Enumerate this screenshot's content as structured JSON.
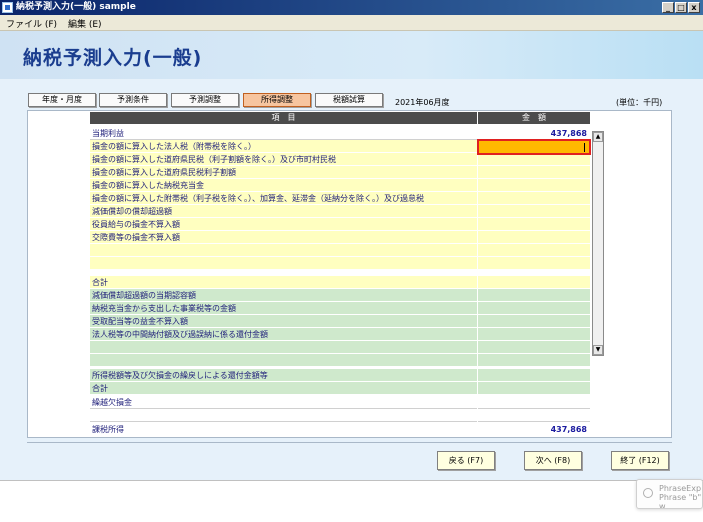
{
  "window": {
    "title": "納税予測入力(一般) sample",
    "minimize": "_",
    "maximize": "□",
    "close": "x"
  },
  "menu": [
    {
      "label": "ファイル (F)"
    },
    {
      "label": "編集 (E)"
    }
  ],
  "header": {
    "title": "納税予測入力(一般)"
  },
  "tabs": [
    {
      "label": "年度・月度"
    },
    {
      "label": "予測条件"
    },
    {
      "label": "予測調整"
    },
    {
      "label": "所得調整"
    },
    {
      "label": "税額試算"
    }
  ],
  "active_tab": "所得調整",
  "period": "2021年06月度",
  "unit": "(単位：千円)",
  "columns": {
    "item": "項　目",
    "amount": "金　額"
  },
  "rows": [
    {
      "label": "当期利益",
      "amount": "437,868"
    },
    {
      "label": "損金の額に算入した法人税（附帯税を除く。）",
      "amount": ""
    },
    {
      "label": "損金の額に算入した道府県民税（利子割額を除く。）及び市町村民税",
      "amount": ""
    },
    {
      "label": "損金の額に算入した道府県民税利子割額",
      "amount": ""
    },
    {
      "label": "損金の額に算入した納税充当金",
      "amount": ""
    },
    {
      "label": "損金の額に算入した附帯税（利子税を除く。）、加算金、延滞金（延納分を除く。）及び過怠税",
      "amount": ""
    },
    {
      "label": "減価償却の償却超過額",
      "amount": ""
    },
    {
      "label": "役員給与の損金不算入額",
      "amount": ""
    },
    {
      "label": "交際費等の損金不算入額",
      "amount": ""
    },
    {
      "label": "",
      "amount": ""
    },
    {
      "label": "",
      "amount": ""
    },
    {
      "label": "合計",
      "amount": ""
    },
    {
      "label": "減価償却超過額の当期認容額",
      "amount": ""
    },
    {
      "label": "納税充当金から支出した事業税等の金額",
      "amount": ""
    },
    {
      "label": "受取配当等の益金不算入額",
      "amount": ""
    },
    {
      "label": "法人税等の中間納付額及び過誤納に係る還付金額",
      "amount": ""
    },
    {
      "label": "",
      "amount": ""
    },
    {
      "label": "",
      "amount": ""
    },
    {
      "label": "所得税額等及び欠損金の繰戻しによる還付金額等",
      "amount": ""
    },
    {
      "label": "合計",
      "amount": ""
    },
    {
      "label": "繰越欠損金",
      "amount": ""
    },
    {
      "label": "",
      "amount": ""
    },
    {
      "label": "課税所得",
      "amount": "437,868"
    }
  ],
  "buttons": {
    "back": "戻る (F7)",
    "next": "次へ (F8)",
    "exit": "終了 (F12)"
  },
  "ime": {
    "line1": "PhraseExp",
    "line2": "Phrase \"b\" w"
  },
  "colors": {
    "header_text": "#1a3d8f",
    "active_tab": "#f7c59f",
    "add_rows": "#ffffc0",
    "deduct_rows": "#cfe9cc",
    "selected_cell": "#ffb800",
    "selected_border": "#e02020"
  }
}
